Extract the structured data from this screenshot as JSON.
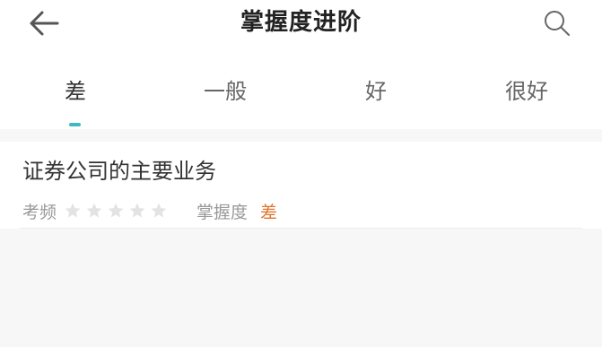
{
  "header": {
    "title": "掌握度进阶",
    "back_icon": "arrow-left-icon",
    "search_icon": "search-icon"
  },
  "tabs": [
    {
      "label": "差",
      "active": true
    },
    {
      "label": "一般",
      "active": false
    },
    {
      "label": "好",
      "active": false
    },
    {
      "label": "很好",
      "active": false
    }
  ],
  "items": [
    {
      "title": "证券公司的主要业务",
      "frequency_label": "考频",
      "frequency_stars": 0,
      "frequency_max": 5,
      "mastery_label": "掌握度",
      "mastery_value": "差"
    }
  ],
  "colors": {
    "accent": "#3fb8c0",
    "mastery_poor": "#e0772f",
    "star_empty": "#e3e3e3",
    "background": "#f7f7f7"
  }
}
